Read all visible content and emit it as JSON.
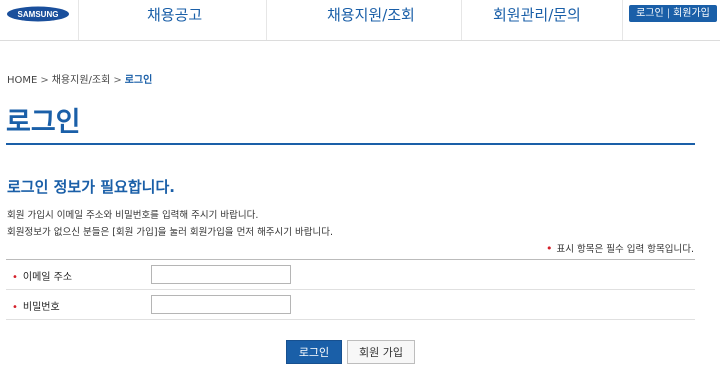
{
  "header": {
    "logo_text": "SAMSUNG",
    "nav": [
      {
        "label": "채용공고"
      },
      {
        "label": "채용지원/조회"
      },
      {
        "label": "회원관리/문의"
      }
    ],
    "util": {
      "login": "로그인",
      "separator": "|",
      "join": "회원가입"
    },
    "accent_color": "#1a5fa8"
  },
  "breadcrumb": {
    "items": [
      "HOME",
      "채용지원/조회",
      "로그인"
    ],
    "arrow": ">"
  },
  "page_title": "로그인",
  "section": {
    "title": "로그인 정보가 필요합니다.",
    "desc1": "회원 가입시 이메일 주소와 비밀번호를 입력해 주시기 바랍니다.",
    "desc2": "회원정보가 없으신 분들은 [회원 가입]을 눌러 회원가입을 먼저 해주시기 바랍니다.",
    "required_note": "표시 항목은 필수 입력 항목입니다.",
    "required_mark": "•"
  },
  "form": {
    "email_label": "이메일 주소",
    "email_value": "",
    "password_label": "비밀번호",
    "password_value": ""
  },
  "buttons": {
    "login": "로그인",
    "join": "회원 가입"
  }
}
